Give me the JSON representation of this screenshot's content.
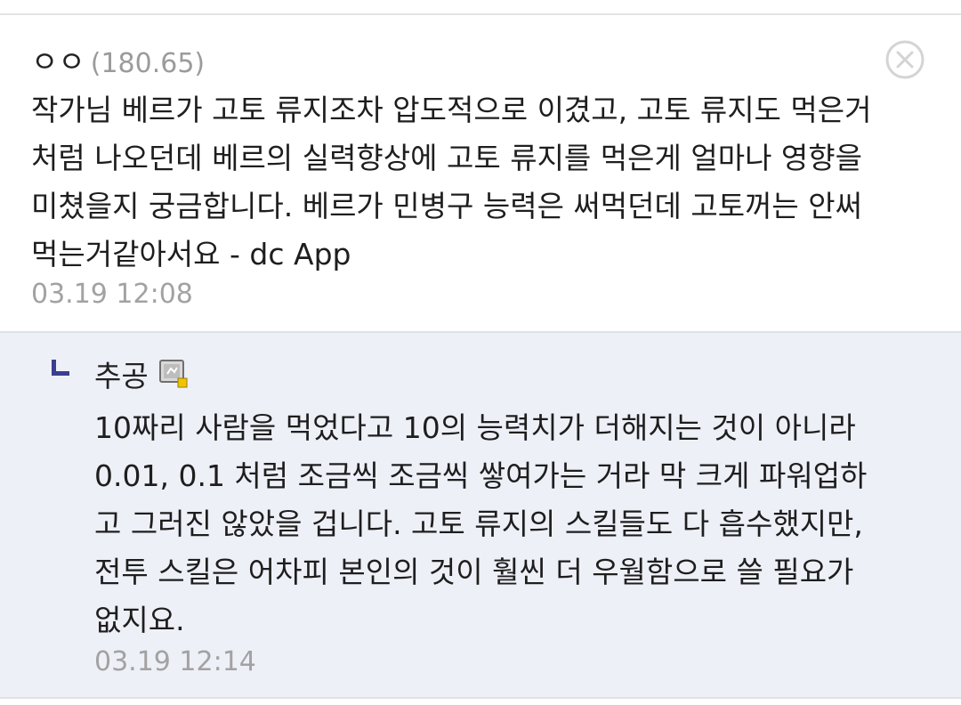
{
  "comment": {
    "author": "ㅇㅇ",
    "ip": "(180.65)",
    "body_lines": [
      "작가님 베르가 고토 류지조차 압도적으로 이겼고, 고토 류지도 먹은거",
      "처럼 나오던데 베르의 실력향상에 고토 류지를 먹은게 얼마나 영향을",
      "미쳤을지 궁금합니다. 베르가 민병구 능력은 써먹던데 고토꺼는 안써",
      "먹는거같아서요 - dc App"
    ],
    "time": "03.19 12:08",
    "delete_icon": "close-circle-icon"
  },
  "reply": {
    "author": "추공",
    "author_badge_icon": "fixed-nickname-icon",
    "marker_icon": "reply-arrow-icon",
    "body_lines": [
      "10짜리 사람을 먹었다고 10의 능력치가 더해지는 것이 아니라",
      "0.01, 0.1 처럼 조금씩 조금씩 쌓여가는 거라 막 크게 파워업하",
      "고 그러진 않았을 겁니다. 고토 류지의 스킬들도 다 흡수했지만,",
      "전투 스킬은 어차피 본인의 것이 훨씬 더 우월함으로 쓸 필요가",
      "없지요."
    ],
    "time": "03.19 12:14"
  },
  "colors": {
    "reply_background": "#eef0f8",
    "marker": "#3a3f8f",
    "timestamp": "#a2a2a2"
  }
}
